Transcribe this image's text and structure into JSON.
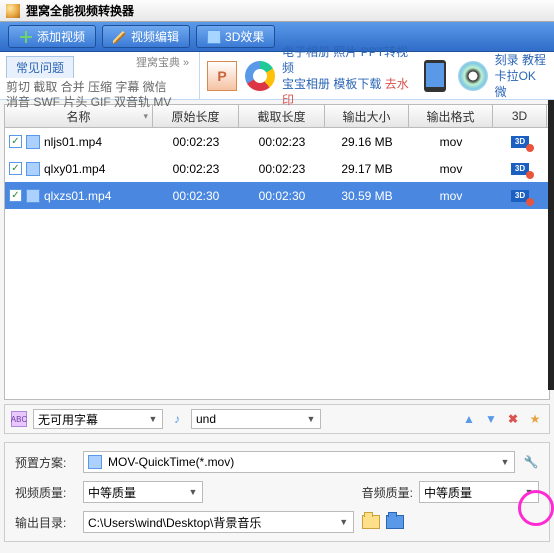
{
  "title": "狸窝全能视频转换器",
  "toolbar": {
    "add": "添加视频",
    "edit": "视频编辑",
    "effect": "3D效果"
  },
  "faq": {
    "tab": "常见问题",
    "hint": "狸窝宝典 »",
    "row1": "剪切 截取 合并 压缩 字幕 微信",
    "row2": "消音 SWF 片头 GIF 双音轨 MV",
    "mid": {
      "a": "电子相册",
      "b": "照片",
      "c": "PPT转视频",
      "d": "宝宝相册",
      "e": "模板下载",
      "f": "去水印"
    },
    "right": {
      "a": "刻录",
      "b": "教程",
      "c": "卡拉OK",
      "d": "微"
    }
  },
  "cols": [
    "名称",
    "原始长度",
    "截取长度",
    "输出大小",
    "输出格式",
    "3D"
  ],
  "rows": [
    {
      "name": "nljs01.mp4",
      "orig": "00:02:23",
      "cut": "00:02:23",
      "size": "29.16 MB",
      "fmt": "mov",
      "sel": false
    },
    {
      "name": "qlxy01.mp4",
      "orig": "00:02:23",
      "cut": "00:02:23",
      "size": "29.17 MB",
      "fmt": "mov",
      "sel": false
    },
    {
      "name": "qlxzs01.mp4",
      "orig": "00:02:30",
      "cut": "00:02:30",
      "size": "30.59 MB",
      "fmt": "mov",
      "sel": true
    }
  ],
  "sub": {
    "none": "无可用字幕",
    "lang": "und"
  },
  "preset": {
    "lbl": "预置方案:",
    "val": "MOV-QuickTime(*.mov)"
  },
  "vq": {
    "lbl": "视频质量:",
    "val": "中等质量"
  },
  "aq": {
    "lbl": "音频质量:",
    "val": "中等质量"
  },
  "out": {
    "lbl": "输出目录:",
    "val": "C:\\Users\\wind\\Desktop\\背景音乐"
  }
}
